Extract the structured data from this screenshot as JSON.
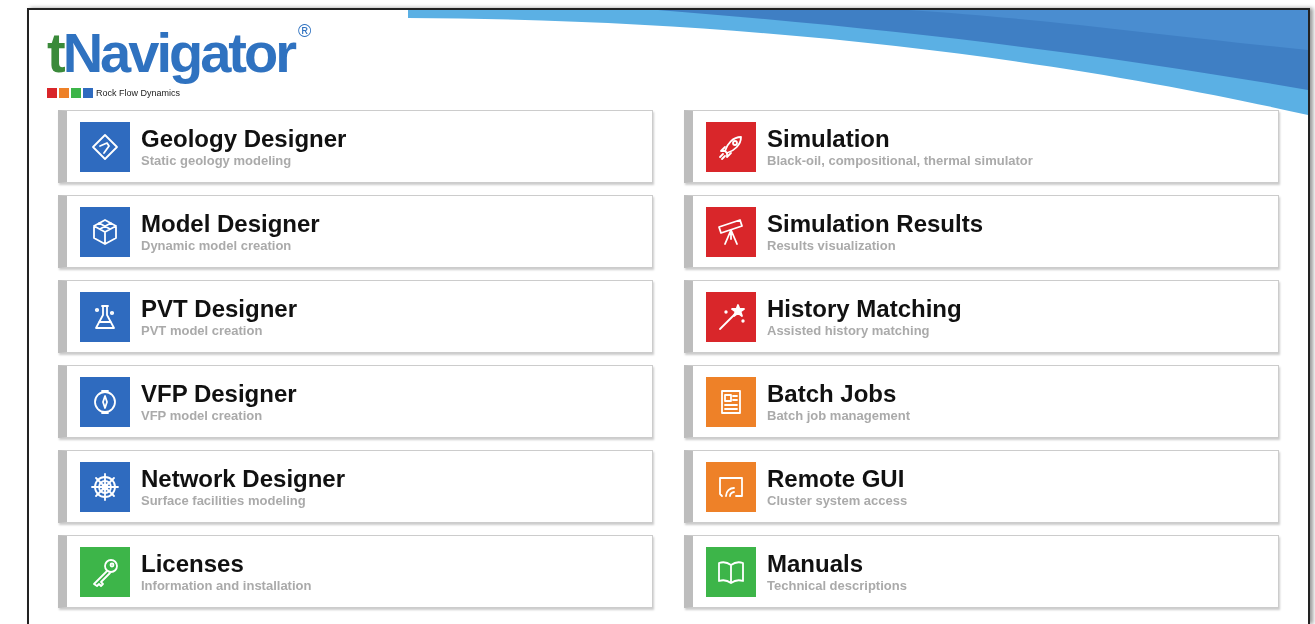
{
  "logo": {
    "lead": "t",
    "name": "Navigator",
    "mark": "®",
    "tagline": "Rock Flow Dynamics"
  },
  "modules": [
    {
      "title": "Geology Designer",
      "subtitle": "Static geology modeling",
      "color": "#2f6bbf"
    },
    {
      "title": "Simulation",
      "subtitle": "Black-oil, compositional, thermal simulator",
      "color": "#d9262a"
    },
    {
      "title": "Model Designer",
      "subtitle": "Dynamic model creation",
      "color": "#2f6bbf"
    },
    {
      "title": "Simulation Results",
      "subtitle": "Results visualization",
      "color": "#d9262a"
    },
    {
      "title": "PVT Designer",
      "subtitle": "PVT model creation",
      "color": "#2f6bbf"
    },
    {
      "title": "History Matching",
      "subtitle": "Assisted history matching",
      "color": "#d9262a"
    },
    {
      "title": "VFP Designer",
      "subtitle": "VFP model creation",
      "color": "#2f6bbf"
    },
    {
      "title": "Batch Jobs",
      "subtitle": "Batch job management",
      "color": "#ee8128"
    },
    {
      "title": "Network Designer",
      "subtitle": "Surface facilities modeling",
      "color": "#2f6bbf"
    },
    {
      "title": "Remote GUI",
      "subtitle": "Cluster system access",
      "color": "#ee8128"
    },
    {
      "title": "Licenses",
      "subtitle": "Information and installation",
      "color": "#3db549"
    },
    {
      "title": "Manuals",
      "subtitle": "Technical descriptions",
      "color": "#3db549"
    }
  ]
}
